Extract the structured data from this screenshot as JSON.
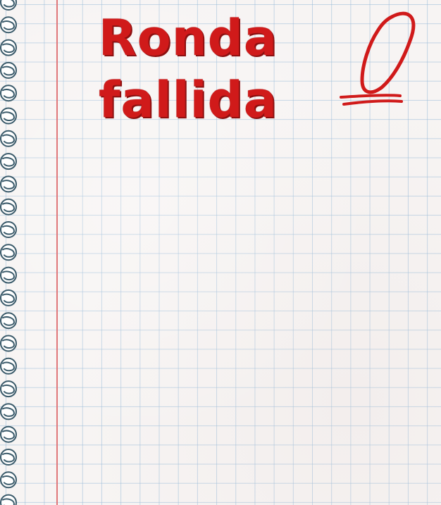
{
  "title": {
    "line1": "Ronda",
    "line2": "fallida"
  },
  "score": {
    "value": "0"
  },
  "colors": {
    "title_red": "#d01a1a",
    "margin_line": "#e0777a",
    "grid": "#96b9d7",
    "paper": "#f7f4f3"
  },
  "icons": {
    "spiral": "spiral-binding-icon",
    "score": "handwritten-zero-icon"
  }
}
